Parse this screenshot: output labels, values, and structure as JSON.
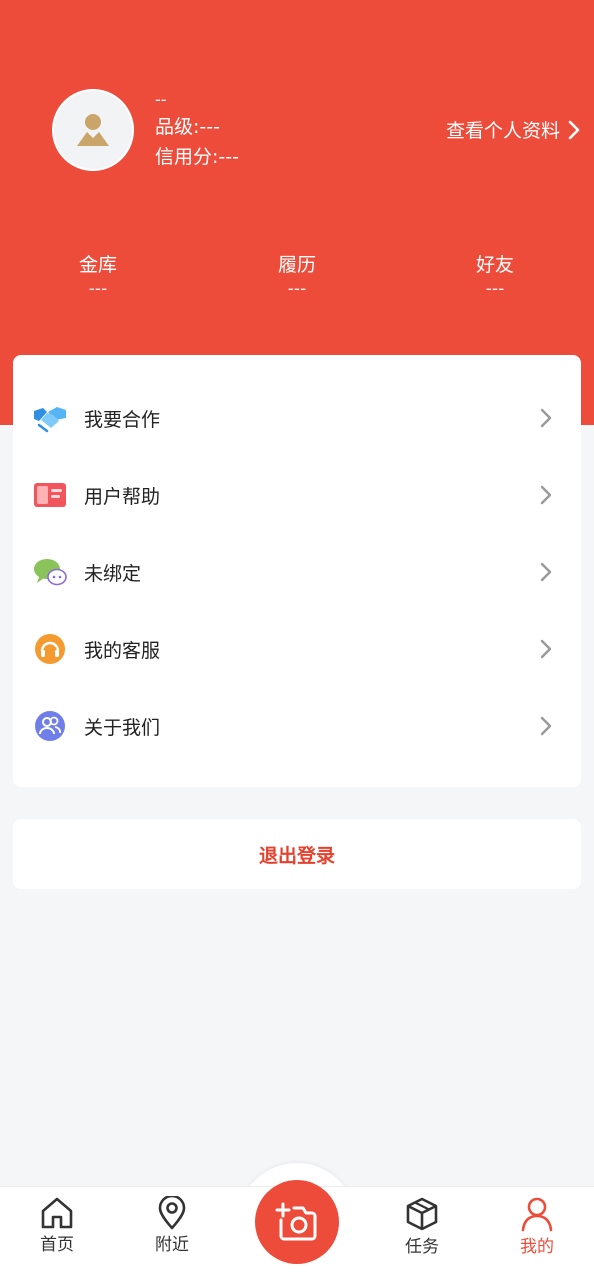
{
  "profile": {
    "nickname": "--",
    "level_text": "品级:---",
    "credit_text": "信用分:---",
    "view_profile_label": "查看个人资料"
  },
  "stats": [
    {
      "label": "金库",
      "value": "---"
    },
    {
      "label": "履历",
      "value": "---"
    },
    {
      "label": "好友",
      "value": "---"
    }
  ],
  "menu": [
    {
      "label": "我要合作",
      "icon": "handshake-icon"
    },
    {
      "label": "用户帮助",
      "icon": "book-icon"
    },
    {
      "label": "未绑定",
      "icon": "wechat-icon"
    },
    {
      "label": "我的客服",
      "icon": "headset-icon"
    },
    {
      "label": "关于我们",
      "icon": "users-icon"
    }
  ],
  "logout_label": "退出登录",
  "tabbar": {
    "items": [
      {
        "label": "首页",
        "icon": "home-icon"
      },
      {
        "label": "附近",
        "icon": "location-pin-icon"
      },
      {
        "label": "",
        "icon": "camera-add-icon"
      },
      {
        "label": "任务",
        "icon": "box-icon"
      },
      {
        "label": "我的",
        "icon": "user-icon"
      }
    ],
    "active_index": 4
  },
  "colors": {
    "brand_red": "#ee4c3a",
    "page_bg": "#f5f6f8",
    "card_bg": "#ffffff",
    "text_dark": "#222222",
    "chevron": "#999999"
  }
}
